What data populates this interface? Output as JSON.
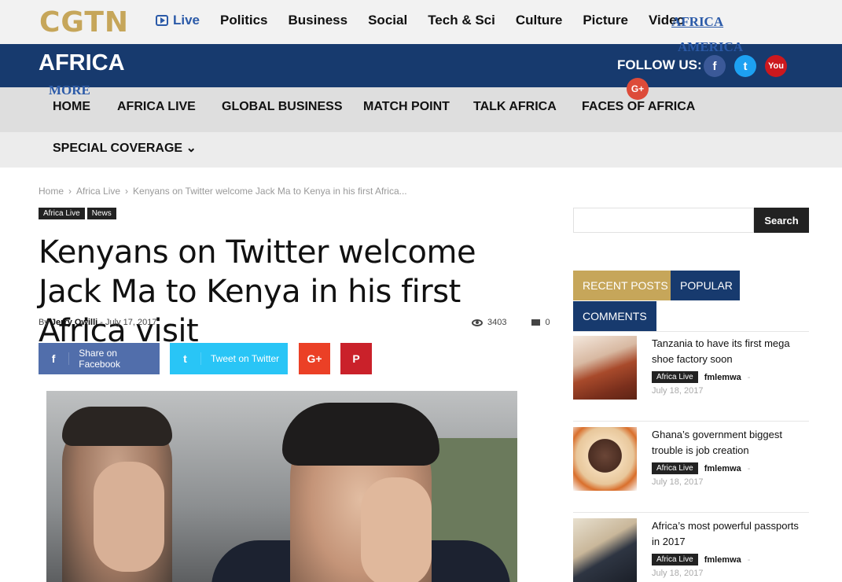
{
  "logo": "CGTN",
  "top_nav": {
    "live": "Live",
    "items": [
      "Politics",
      "Business",
      "Social",
      "Tech & Sci",
      "Culture",
      "Picture",
      "Video"
    ],
    "africa": "AFRICA",
    "america": "AMERICA",
    "more": "MORE"
  },
  "section": {
    "title": "AFRICA",
    "follow_label": "FOLLOW US:"
  },
  "social": {
    "fb": "f",
    "tw": "t",
    "yt": "You",
    "gp": "G+"
  },
  "menu": {
    "row1": [
      "HOME",
      "AFRICA LIVE",
      "GLOBAL BUSINESS",
      "MATCH POINT",
      "TALK AFRICA",
      "FACES OF AFRICA"
    ],
    "row2": [
      "SPECIAL COVERAGE ⌄"
    ]
  },
  "breadcrumb": [
    "Home",
    "›",
    "Africa Live",
    "›",
    "Kenyans on Twitter welcome Jack Ma to Kenya in his first Africa..."
  ],
  "tags": [
    "Africa Live",
    "News"
  ],
  "article": {
    "headline": "Kenyans on Twitter welcome Jack Ma to Kenya in his first Africa visit",
    "by": "By",
    "author": "Jerry Owilli",
    "sep": "-",
    "date": "July 17, 2017",
    "views": "3403",
    "comments": "0"
  },
  "share": {
    "facebook": "Share on Facebook",
    "twitter": "Tweet on Twitter",
    "fb_icon": "f",
    "tw_icon": "t",
    "gp": "G+",
    "pi": "P"
  },
  "sidebar": {
    "search_button": "Search",
    "tabs": {
      "recent": "RECENT POSTS",
      "popular": "POPULAR",
      "comments": "COMMENTS"
    },
    "posts": [
      {
        "title": "Tanzania to have its first mega shoe factory soon",
        "category": "Africa Live",
        "author": "fmlemwa",
        "dash": "-",
        "date": "July 18, 2017"
      },
      {
        "title": "Ghana’s government biggest trouble is job creation",
        "category": "Africa Live",
        "author": "fmlemwa",
        "dash": "-",
        "date": "July 18, 2017"
      },
      {
        "title": "Africa’s most powerful passports in 2017",
        "category": "Africa Live",
        "author": "fmlemwa",
        "dash": "-",
        "date": "July 18, 2017"
      }
    ]
  }
}
